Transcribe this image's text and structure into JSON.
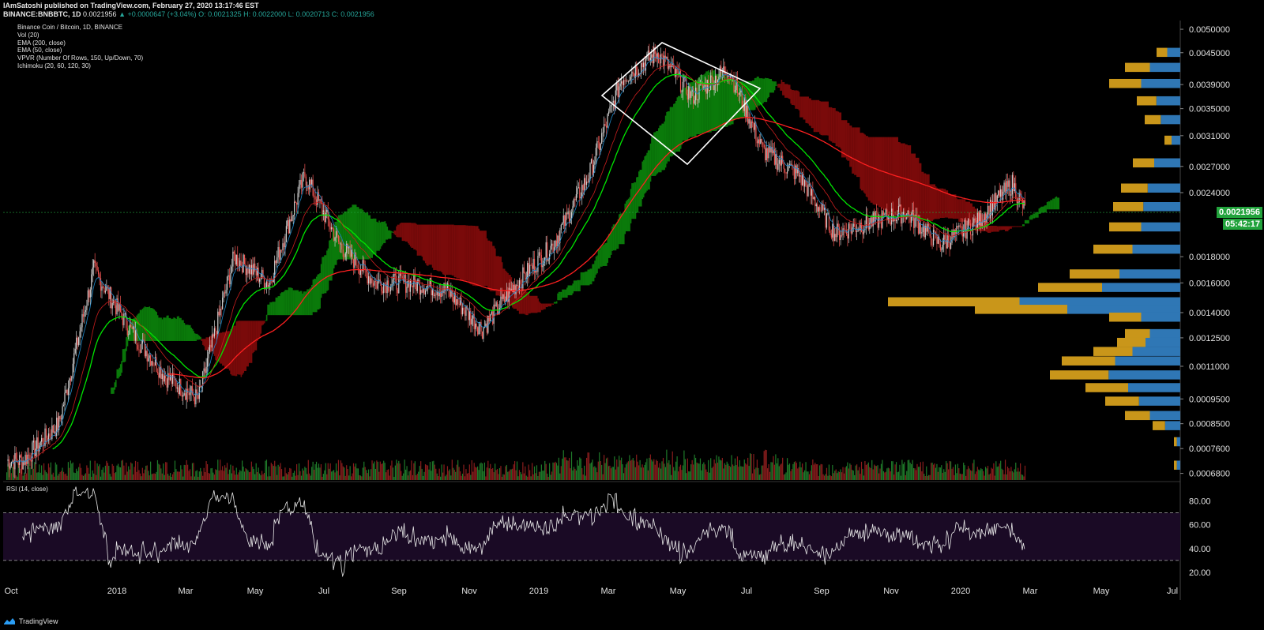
{
  "header": {
    "publisher_line": "IAmSatoshi published on TradingView.com, February 27, 2020 13:17:46 EST",
    "symbol": "BINANCE:BNBBTC, 1D",
    "last": "0.0021956",
    "change": "▲ +0.0000647 (+3.04%)",
    "ohlc": "O: 0.0021325 H: 0.0022000 L: 0.0020713 C: 0.0021956"
  },
  "legend": [
    "Binance Coin / Bitcoin, 1D, BINANCE",
    "Vol (20)",
    "EMA (200, close)",
    "EMA (50, close)",
    "VPVR (Number Of Rows, 150, Up/Down, 70)",
    "Ichimoku (20, 60, 120, 30)"
  ],
  "rsi_title": "RSI (14, close)",
  "footer_brand": "TradingView",
  "price_tags": {
    "current": "0.0021956",
    "countdown": "05:42:17"
  },
  "colors": {
    "up_candle": "#26a69a",
    "down_candle": "#ef5350",
    "ema50": "#00e600",
    "ema200": "#ff2020",
    "cloud_bull": "#0a7a0a",
    "cloud_bear": "#7a0a0a",
    "vp_up": "#2f77b5",
    "vp_down": "#c9961a",
    "rsi_band": "#1a0a25",
    "tag_green": "#22a33c"
  },
  "chart_data": [
    {
      "type": "candlestick",
      "title": "Binance Coin / Bitcoin, 1D, BINANCE",
      "y_axis": {
        "scale": "log",
        "ticks": [
          "0.0050000",
          "0.0045000",
          "0.0039000",
          "0.0035000",
          "0.0031000",
          "0.0027000",
          "0.0024000",
          "0.0021956",
          "0.0018000",
          "0.0016000",
          "0.0014000",
          "0.0012500",
          "0.0011000",
          "0.0009500",
          "0.0008500",
          "0.0007600",
          "0.0006800"
        ],
        "range": [
          0.00066,
          0.0052
        ]
      },
      "x_axis": {
        "ticks": [
          "Oct",
          "2018",
          "Mar",
          "May",
          "Jul",
          "Sep",
          "Nov",
          "2019",
          "Mar",
          "May",
          "Jul",
          "Sep",
          "Nov",
          "2020",
          "Mar",
          "May",
          "Jul"
        ]
      },
      "price_path": [
        [
          "2017-10",
          0.00072
        ],
        [
          "2017-11",
          0.00085
        ],
        [
          "2017-12",
          0.0017
        ],
        [
          "2018-01",
          0.0013
        ],
        [
          "2018-02",
          0.00105
        ],
        [
          "2018-03",
          0.00095
        ],
        [
          "2018-04",
          0.0018
        ],
        [
          "2018-05",
          0.0016
        ],
        [
          "2018-06",
          0.0026
        ],
        [
          "2018-07",
          0.0019
        ],
        [
          "2018-08",
          0.0016
        ],
        [
          "2018-09",
          0.0016
        ],
        [
          "2018-10",
          0.00155
        ],
        [
          "2018-11",
          0.0013
        ],
        [
          "2018-12",
          0.0016
        ],
        [
          "2019-01",
          0.0019
        ],
        [
          "2019-02",
          0.0026
        ],
        [
          "2019-03",
          0.004
        ],
        [
          "2019-04",
          0.0045
        ],
        [
          "2019-05",
          0.0037
        ],
        [
          "2019-06",
          0.0042
        ],
        [
          "2019-07",
          0.0029
        ],
        [
          "2019-08",
          0.0026
        ],
        [
          "2019-09",
          0.002
        ],
        [
          "2019-10",
          0.0021
        ],
        [
          "2019-11",
          0.0022
        ],
        [
          "2019-12",
          0.0019
        ],
        [
          "2020-01",
          0.0021
        ],
        [
          "2020-02",
          0.0025
        ],
        [
          "2020-02-27",
          0.0021956
        ]
      ],
      "annotations": [
        "diamond pattern, Mar–Jul 2019"
      ]
    },
    {
      "type": "line",
      "title": "RSI (14, close)",
      "y_axis": {
        "ticks": [
          "80.00",
          "60.00",
          "40.00",
          "20.00"
        ],
        "range": [
          10,
          95
        ]
      },
      "bands": [
        30,
        70
      ],
      "last_value": 44
    }
  ]
}
